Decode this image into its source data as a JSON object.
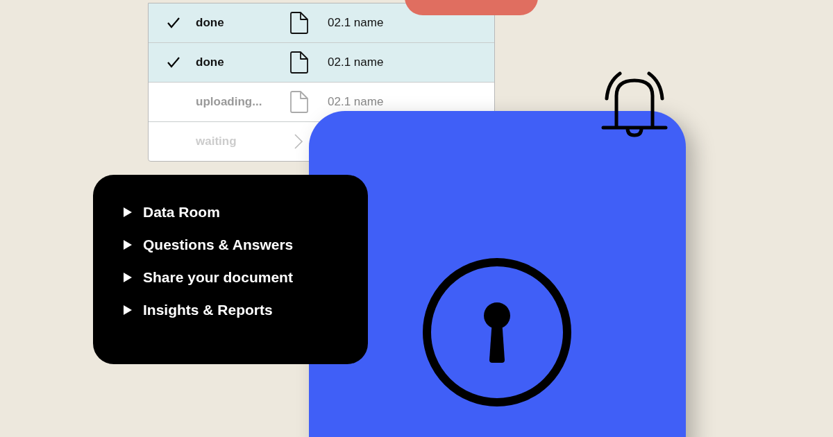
{
  "uploads": [
    {
      "kind": "done",
      "status": "done",
      "name": "02.1 name"
    },
    {
      "kind": "done",
      "status": "done",
      "name": "02.1 name"
    },
    {
      "kind": "uploading",
      "status": "uploading...",
      "name": "02.1 name"
    },
    {
      "kind": "waiting",
      "status": "waiting"
    }
  ],
  "menu": {
    "items": [
      {
        "label": "Data Room"
      },
      {
        "label": "Questions & Answers"
      },
      {
        "label": "Share your document"
      },
      {
        "label": "Insights & Reports"
      }
    ]
  }
}
